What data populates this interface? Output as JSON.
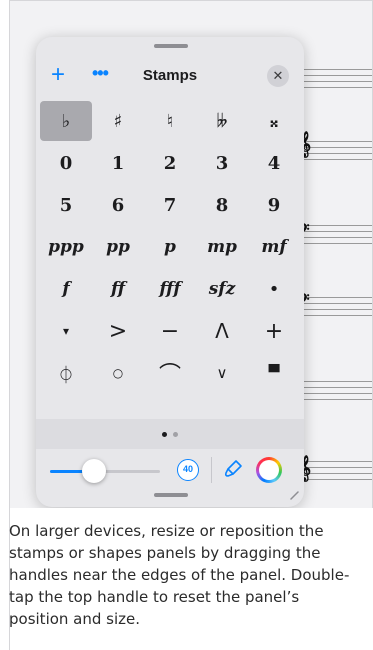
{
  "panel": {
    "title": "Stamps",
    "plus_icon": "+",
    "more_icon": "•••",
    "close_icon": "✕"
  },
  "stamp_rows": [
    [
      "♭",
      "♯",
      "♮",
      "𝄫",
      "𝄪"
    ],
    [
      "0",
      "1",
      "2",
      "3",
      "4"
    ],
    [
      "5",
      "6",
      "7",
      "8",
      "9"
    ],
    [
      "ppp",
      "pp",
      "p",
      "mp",
      "mf"
    ],
    [
      "f",
      "ff",
      "fff",
      "sfz",
      "•"
    ],
    [
      "▾",
      ">",
      "−",
      "Λ",
      "+"
    ],
    [
      "⏀",
      "○",
      "⌒",
      "∨",
      "▀"
    ]
  ],
  "selected_stamp": "♭",
  "pager": {
    "pages": 2,
    "current": 1
  },
  "toolbar": {
    "size_value": "40",
    "slider_fraction": 0.4,
    "accent_color": "#0a84ff"
  },
  "caption": "On larger devices, resize or reposition the stamps or shapes panels by dragging the handles near the edges of the panel. Double-tap the top handle to reset the panel’s position and size."
}
